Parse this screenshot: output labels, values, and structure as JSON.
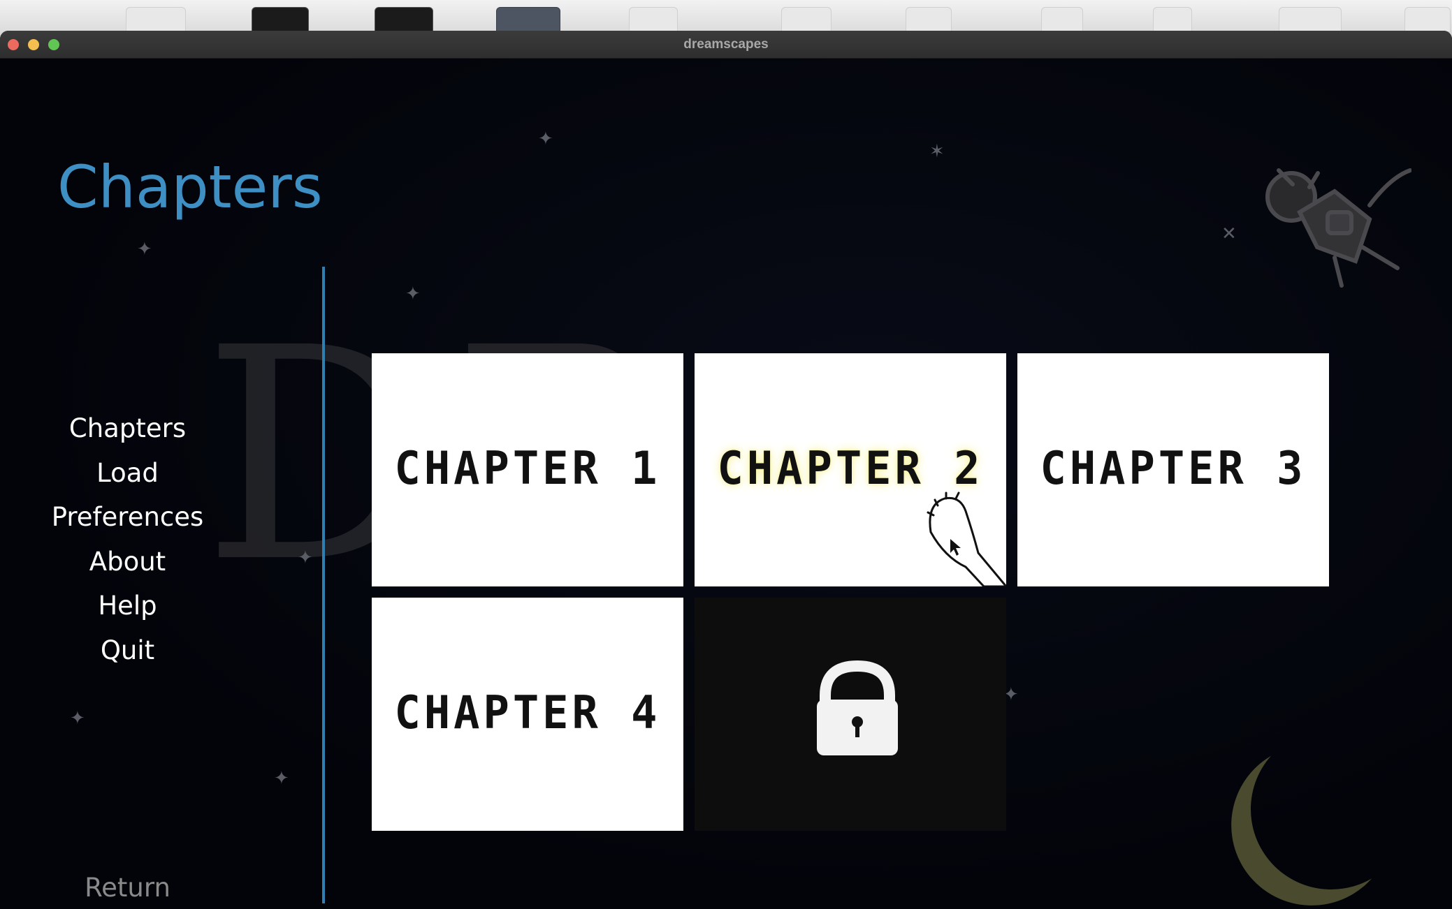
{
  "window": {
    "title": "dreamscapes"
  },
  "screen": {
    "title": "Chapters"
  },
  "nav": {
    "items": [
      {
        "label": "Chapters"
      },
      {
        "label": "Load"
      },
      {
        "label": "Preferences"
      },
      {
        "label": "About"
      },
      {
        "label": "Help"
      },
      {
        "label": "Quit"
      }
    ],
    "return_label": "Return"
  },
  "chapters": [
    {
      "label": "CHAPTER 1",
      "state": "unlocked"
    },
    {
      "label": "CHAPTER 2",
      "state": "hovered"
    },
    {
      "label": "CHAPTER 3",
      "state": "unlocked"
    },
    {
      "label": "CHAPTER 4",
      "state": "unlocked"
    },
    {
      "label": "",
      "state": "locked",
      "icon": "lock-icon"
    }
  ],
  "colors": {
    "title": "#3d8fc4",
    "divider": "#2f7fb0",
    "background": "#03040a"
  }
}
